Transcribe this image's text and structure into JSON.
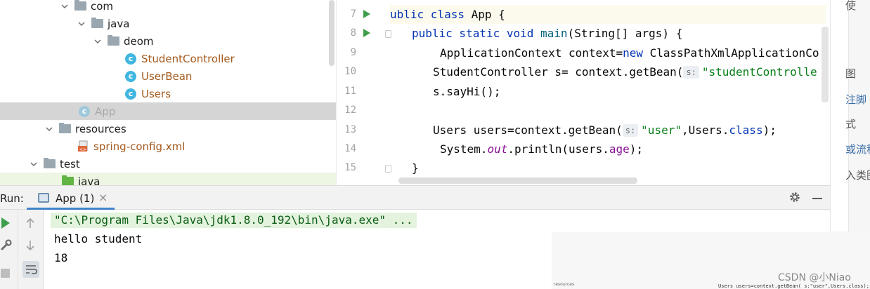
{
  "project_tree": {
    "items": [
      {
        "label": "com",
        "kind": "package",
        "expanded": true,
        "color": "normal"
      },
      {
        "label": "java",
        "kind": "package",
        "expanded": true,
        "color": "normal"
      },
      {
        "label": "deom",
        "kind": "package",
        "expanded": true,
        "color": "normal"
      },
      {
        "label": "StudentController",
        "kind": "class",
        "color": "brown"
      },
      {
        "label": "UserBean",
        "kind": "class",
        "color": "brown"
      },
      {
        "label": "Users",
        "kind": "class",
        "color": "brown"
      },
      {
        "label": "App",
        "kind": "class-run",
        "color": "gray",
        "selected": true
      },
      {
        "label": "resources",
        "kind": "resources-folder",
        "expanded": true,
        "color": "normal"
      },
      {
        "label": "spring-config.xml",
        "kind": "xml-file",
        "color": "brown"
      },
      {
        "label": "test",
        "kind": "folder",
        "expanded": true,
        "color": "normal"
      },
      {
        "label": "java",
        "kind": "test-folder",
        "color": "normal",
        "highlighted": true
      }
    ]
  },
  "editor": {
    "line_numbers": [
      "7",
      "8",
      "9",
      "10",
      "11",
      "12",
      "13",
      "14",
      "15"
    ],
    "lines": [
      {
        "kw1": "ublic class ",
        "name": "App",
        "rest": " {"
      },
      {
        "kw1": "public static void ",
        "fn": "main",
        "rest": "(String[] args) {"
      },
      {
        "text": "ApplicationContext context=",
        "kw": "new",
        "rest": " ClassPathXmlApplicationCo"
      },
      {
        "text": "StudentController s= context.getBean(",
        "hint": "s:",
        "str": "\"studentControlle"
      },
      {
        "text": "s.sayHi();"
      },
      {
        "text": ""
      },
      {
        "text": "Users users=context.getBean(",
        "hint": "s:",
        "str": "\"user\"",
        "rest1": ",Users.",
        "kw": "class",
        "rest2": ");"
      },
      {
        "text": "System.",
        "italic": "out",
        "mid": ".println(users.",
        "field": "age",
        "rest": ");"
      },
      {
        "text": "}"
      }
    ]
  },
  "run_panel": {
    "title": "Run:",
    "tab_label": "App (1)",
    "tab_close": "×",
    "gear_icon": "gear-icon",
    "console": {
      "command": "\"C:\\Program Files\\Java\\jdk1.8.0_192\\bin\\java.exe\" ...",
      "output": [
        "hello student",
        "18"
      ]
    }
  },
  "right_panel": {
    "top_text": "使",
    "items": [
      "图",
      "注脚",
      "式",
      "或流程",
      "入类图"
    ]
  },
  "overlay": {
    "watermark": "CSDN @小Niao",
    "thumb_left": "resources",
    "thumb_right": "Users users=context.getBean( s:\"user\",Users.class);"
  },
  "colors": {
    "keyword": "#0033b3",
    "string": "#067d17",
    "method": "#00627a",
    "field": "#871094",
    "run_green": "#3f9e4a",
    "tab_underline": "#4083c9"
  }
}
